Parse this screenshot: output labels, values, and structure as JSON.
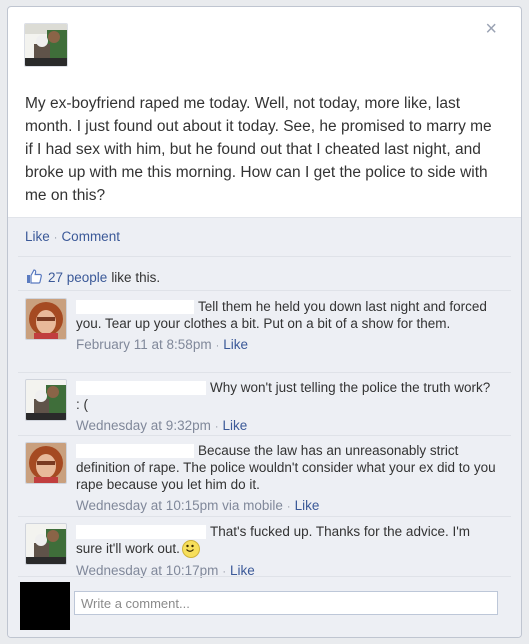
{
  "post": {
    "text": "My ex-boyfriend raped me today. Well, not today, more like, last month. I just found out about it today. See, he promised to marry me if I had sex with him, but he found out that I cheated last night, and broke up with me this morning. How can I get the police to side with me on this?"
  },
  "actions": {
    "like_label": "Like",
    "comment_label": "Comment"
  },
  "likes": {
    "count_text": "27 people",
    "suffix": "like this."
  },
  "comments": [
    {
      "text": "Tell them he held you down last night and forced you. Tear up your clothes a bit. Put on a bit of a show for them.",
      "time": "February 11 at 8:58pm",
      "like_label": "Like"
    },
    {
      "text": "Why won't just telling the police the truth work? : (",
      "time": "Wednesday at 9:32pm",
      "like_label": "Like"
    },
    {
      "text": "Because the law has an unreasonably strict definition of rape. The police wouldn't consider what your ex did to you rape because you let him do it.",
      "time": "Wednesday at 10:15pm",
      "via": "via mobile",
      "like_label": "Like"
    },
    {
      "text": "That's fucked up. Thanks for the advice. I'm sure it'll work out.",
      "time": "Wednesday at 10:17pm",
      "like_label": "Like"
    }
  ],
  "composer": {
    "placeholder": "Write a comment..."
  },
  "icons": {
    "close": "close-icon",
    "thumbs": "thumbs-up-icon",
    "smiley": "smiley-emoticon-icon"
  },
  "colors": {
    "link": "#3b5998",
    "feedback_bg": "#edeff4"
  }
}
